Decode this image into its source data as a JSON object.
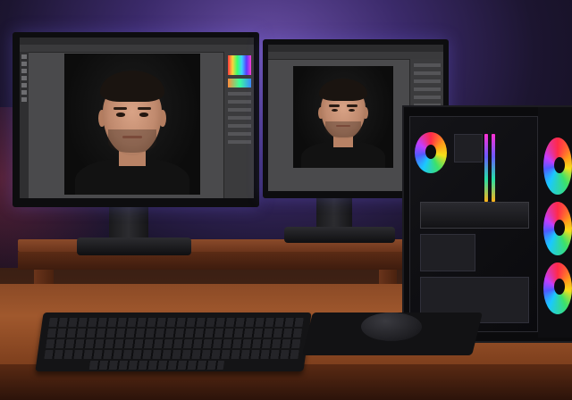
{
  "scene": {
    "description_tags": [
      "dual-monitor",
      "photo-editing",
      "gaming-pc",
      "rgb-fans",
      "keyboard",
      "mouse"
    ],
    "accent_colors": {
      "backlight": "#6a4fa6",
      "fan_rgb": [
        "#ff2a4a",
        "#ff9d1a",
        "#f5e01a",
        "#3ce16a",
        "#1ac8ff",
        "#4f5bff",
        "#c43cff"
      ],
      "desk_wood": "#a0582d"
    }
  }
}
